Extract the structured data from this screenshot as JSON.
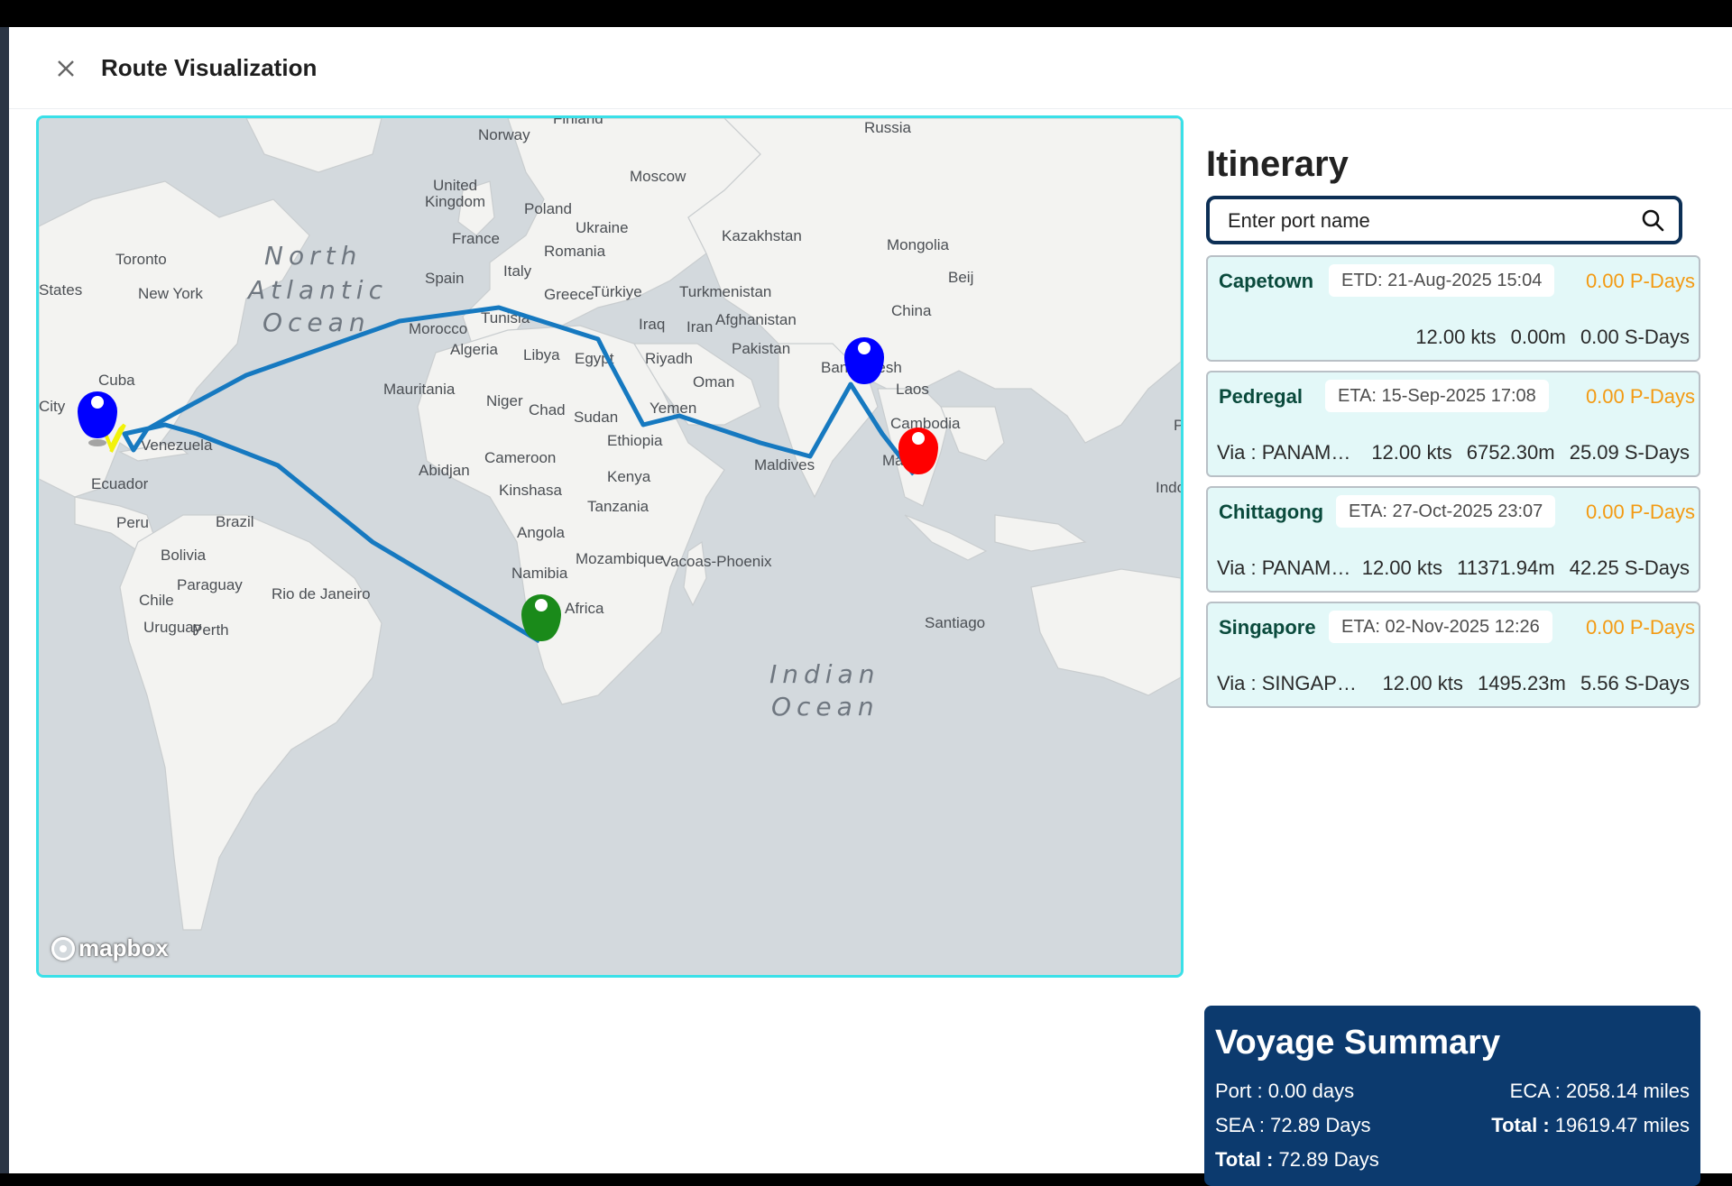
{
  "header": {
    "title": "Route Visualization"
  },
  "map": {
    "attribution": "mapbox",
    "oceans": [
      "North",
      "Atlantic",
      "Ocean",
      "Indian",
      "Ocean"
    ],
    "places": [
      "Finland",
      "Norway",
      "Russia",
      "Moscow",
      "United",
      "Kingdom",
      "Poland",
      "Ukraine",
      "Kazakhstan",
      "Mongolia",
      "France",
      "Romania",
      "Toronto",
      "States",
      "New York",
      "Spain",
      "Italy",
      "Greece",
      "Türkiye",
      "Turkmenistan",
      "Beij",
      "China",
      "Morocco",
      "Tunisia",
      "Iraq",
      "Iran",
      "Afghanistan",
      "Algeria",
      "Libya",
      "Egypt",
      "Riyadh",
      "Pakistan",
      "Bangladesh",
      "Cuba",
      "Mauritania",
      "Oman",
      "Laos",
      "City",
      "Niger",
      "Chad",
      "Sudan",
      "Yemen",
      "Cambodia",
      "P",
      "Venezuela",
      "Ethiopia",
      "Abidjan",
      "Cameroon",
      "Maldives",
      "Ma",
      "Indo",
      "Ecuador",
      "Kenya",
      "Kinshasa",
      "Tanzania",
      "Peru",
      "Brazil",
      "Angola",
      "Bolivia",
      "Namibia",
      "Mozambique",
      "Vacoas-Phoenix",
      "Paraguay",
      "Rio de Janeiro",
      "Chile",
      "Africa",
      "Perth",
      "Santiago",
      "Uruguay"
    ],
    "markers": {
      "blue": "#0000ff",
      "red": "#ff0000",
      "green": "#1a8a1a",
      "yellow": "#f2f20a",
      "route": "#1679c0"
    }
  },
  "itinerary": {
    "title": "Itinerary",
    "search_placeholder": "Enter port name",
    "ports": [
      {
        "name": "Capetown",
        "date": "ETD: 21-Aug-2025 15:04",
        "pdays": "0.00 P-Days",
        "via": "",
        "speed": "12.00 kts",
        "distance": "0.00m",
        "sdays": "0.00 S-Days"
      },
      {
        "name": "Pedregal",
        "date": "ETA: 15-Sep-2025 17:08",
        "pdays": "0.00 P-Days",
        "via": "Via : PANAMA CANAL",
        "speed": "12.00 kts",
        "distance": "6752.30m",
        "sdays": "25.09 S-Days"
      },
      {
        "name": "Chittagong",
        "date": "ETA: 27-Oct-2025 23:07",
        "pdays": "0.00 P-Days",
        "via": "Via : PANAMA CANAL",
        "speed": "12.00 kts",
        "distance": "11371.94m",
        "sdays": "42.25 S-Days"
      },
      {
        "name": "Singapore",
        "date": "ETA: 02-Nov-2025 12:26",
        "pdays": "0.00 P-Days",
        "via": "Via : SINGAPORE STRAIT",
        "speed": "12.00 kts",
        "distance": "1495.23m",
        "sdays": "5.56 S-Days"
      }
    ]
  },
  "summary": {
    "title": "Voyage Summary",
    "port_label": "Port :",
    "port_value": "0.00 days",
    "sea_label": "SEA :",
    "sea_value": "72.89 Days",
    "total_days_label": "Total :",
    "total_days_value": "72.89 Days",
    "eca_label": "ECA :",
    "eca_value": "2058.14 miles",
    "total_miles_label": "Total :",
    "total_miles_value": "19619.47 miles"
  }
}
